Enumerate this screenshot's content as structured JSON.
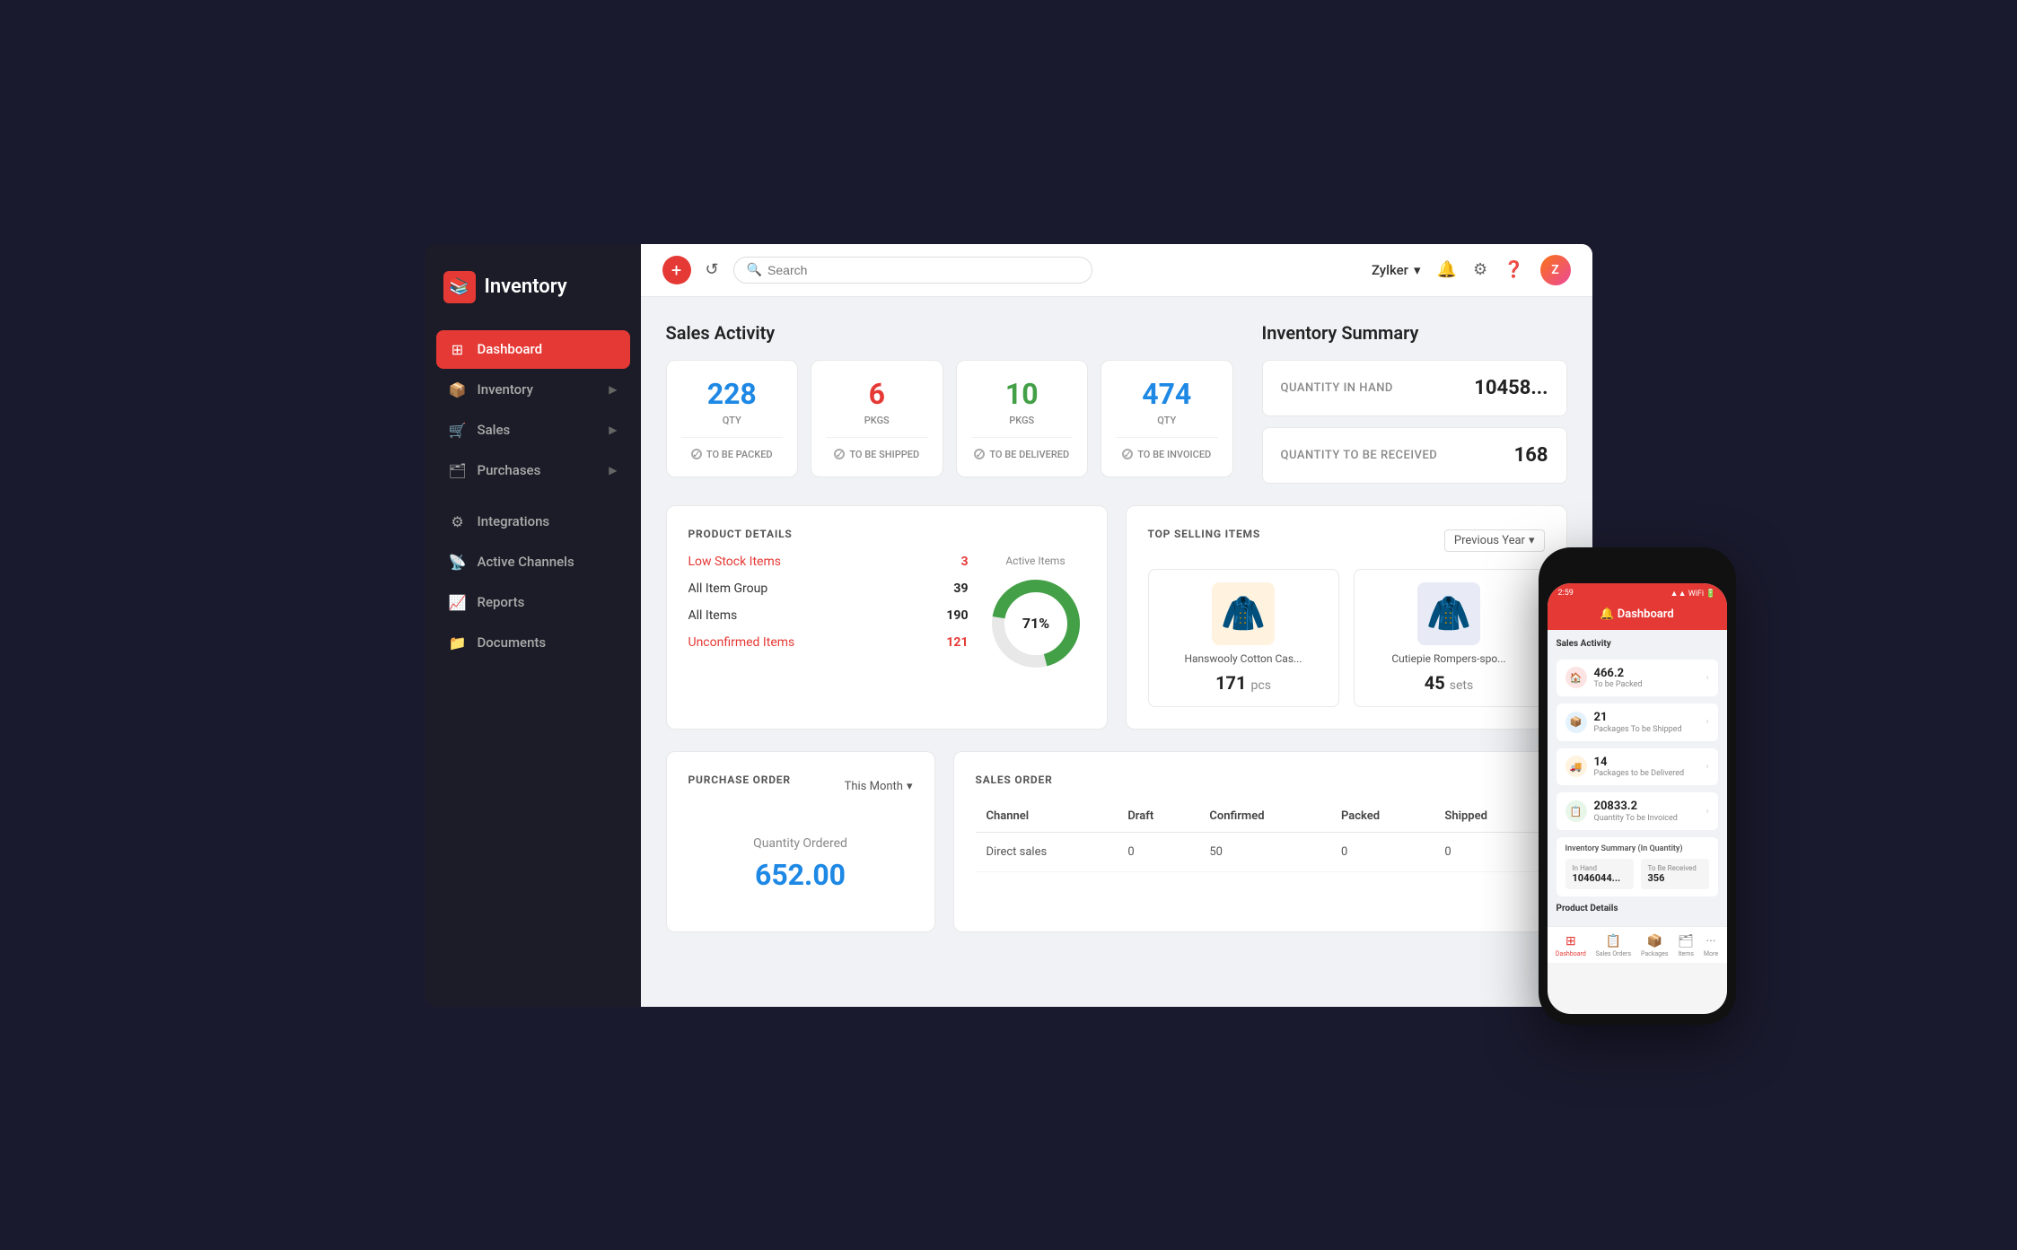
{
  "app": {
    "name": "Inventory",
    "logo_icon": "📚"
  },
  "topbar": {
    "search_placeholder": "Search",
    "org_name": "Zylker"
  },
  "sidebar": {
    "items": [
      {
        "id": "dashboard",
        "label": "Dashboard",
        "icon": "⊞",
        "active": true
      },
      {
        "id": "inventory",
        "label": "Inventory",
        "icon": "📦",
        "has_arrow": true
      },
      {
        "id": "sales",
        "label": "Sales",
        "icon": "🛒",
        "has_arrow": true
      },
      {
        "id": "purchases",
        "label": "Purchases",
        "icon": "🗂",
        "has_arrow": true
      },
      {
        "id": "integrations",
        "label": "Integrations",
        "icon": "⚙"
      },
      {
        "id": "active-channels",
        "label": "Active Channels",
        "icon": "📡"
      },
      {
        "id": "reports",
        "label": "Reports",
        "icon": "📈"
      },
      {
        "id": "documents",
        "label": "Documents",
        "icon": "📁"
      }
    ]
  },
  "sales_activity": {
    "title": "Sales Activity",
    "cards": [
      {
        "number": "228",
        "color": "blue",
        "sub": "Qty",
        "label": "TO BE PACKED"
      },
      {
        "number": "6",
        "color": "red",
        "sub": "Pkgs",
        "label": "TO BE SHIPPED"
      },
      {
        "number": "10",
        "color": "green",
        "sub": "Pkgs",
        "label": "TO BE DELIVERED"
      },
      {
        "number": "474",
        "color": "blue",
        "sub": "Qty",
        "label": "TO BE INVOICED"
      }
    ]
  },
  "inventory_summary": {
    "title": "Inventory Summary",
    "items": [
      {
        "label": "QUANTITY IN HAND",
        "value": "10458..."
      },
      {
        "label": "QUANTITY TO BE RECEIVED",
        "value": "168"
      }
    ]
  },
  "product_details": {
    "title": "PRODUCT DETAILS",
    "rows": [
      {
        "name": "Low Stock Items",
        "count": "3",
        "is_red": true
      },
      {
        "name": "All Item Group",
        "count": "39",
        "is_red": false
      },
      {
        "name": "All Items",
        "count": "190",
        "is_red": false
      },
      {
        "name": "Unconfirmed Items",
        "count": "121",
        "is_red": true
      }
    ],
    "active_items_label": "Active Items",
    "donut_percent": 71,
    "donut_label": "71%"
  },
  "top_selling": {
    "title": "TOP SELLING ITEMS",
    "filter_label": "Previous Year",
    "items": [
      {
        "name": "Hanswooly Cotton Cas...",
        "qty": "171",
        "unit": "pcs",
        "emoji": "🧥",
        "bg": "#fff3e0"
      },
      {
        "name": "Cutiepie Rompers-spo...",
        "qty": "45",
        "unit": "sets",
        "emoji": "🧥",
        "bg": "#e8eaf6"
      }
    ]
  },
  "purchase_order": {
    "title": "PURCHASE ORDER",
    "filter_label": "This Month",
    "body_label": "Quantity Ordered",
    "amount": "652.00"
  },
  "sales_order": {
    "title": "SALES ORDER",
    "headers": [
      "Channel",
      "Draft",
      "Confirmed",
      "Packed",
      "Shipped"
    ],
    "rows": [
      {
        "channel": "Direct sales",
        "draft": "0",
        "confirmed": "50",
        "packed": "0",
        "shipped": "0"
      }
    ]
  },
  "mobile": {
    "time": "2:59",
    "header_title": "Dashboard",
    "sales_activity_title": "Sales Activity",
    "activity_items": [
      {
        "number": "466.2",
        "label": "To be Packed",
        "icon_color": "#e53935",
        "icon": "🏠"
      },
      {
        "number": "21",
        "label": "Packages To be Shipped",
        "icon_color": "#1e88e5",
        "icon": "📦"
      },
      {
        "number": "14",
        "label": "Packages to be Delivered",
        "icon_color": "#fb8c00",
        "icon": "🚚"
      },
      {
        "number": "20833.2",
        "label": "Quantity To be Invoiced",
        "icon_color": "#43a047",
        "icon": "📋"
      }
    ],
    "inv_summary_label": "Inventory Summary (In Quantity)",
    "in_hand_label": "In Hand",
    "in_hand_value": "1046044...",
    "to_receive_label": "To Be Received",
    "to_receive_value": "356",
    "product_details_label": "Product Details",
    "nav": [
      {
        "label": "Dashboard",
        "active": true,
        "icon": "⊞"
      },
      {
        "label": "Sales Orders",
        "active": false,
        "icon": "📋"
      },
      {
        "label": "Packages",
        "active": false,
        "icon": "📦"
      },
      {
        "label": "Items",
        "active": false,
        "icon": "🗂"
      },
      {
        "label": "More",
        "active": false,
        "icon": "···"
      }
    ]
  }
}
